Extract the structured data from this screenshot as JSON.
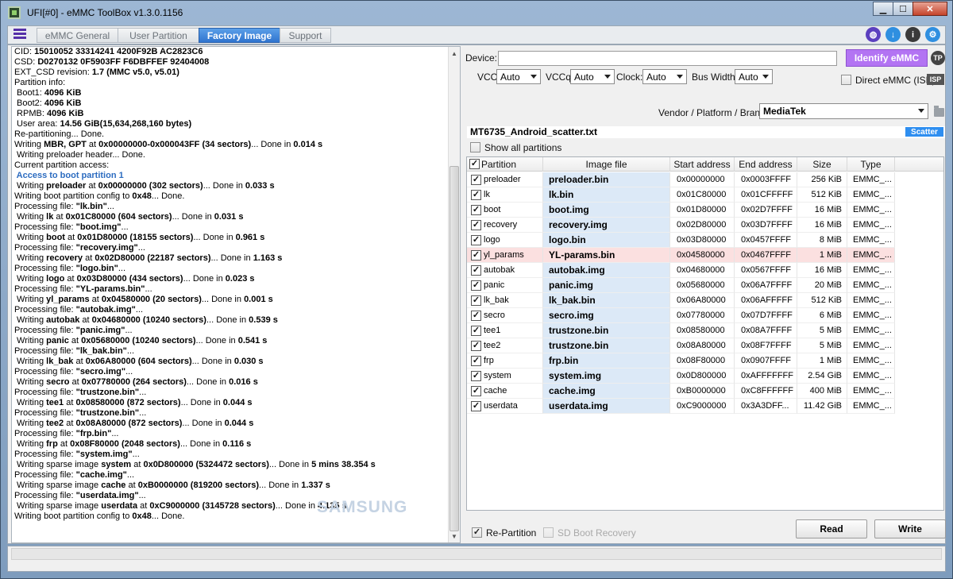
{
  "window": {
    "title": "UFI[#0] - eMMC ToolBox v1.3.0.1156"
  },
  "tabs": [
    {
      "label": "eMMC General",
      "active": false
    },
    {
      "label": "User Partition",
      "active": false
    },
    {
      "label": "Factory Image",
      "active": true
    },
    {
      "label": "Support",
      "active": false
    }
  ],
  "log": {
    "watermark": "SAMSUNG",
    "lines": [
      {
        "t": "CID: ",
        "b": "15010052 33314241 4200F92B AC2823C6"
      },
      {
        "t": "CSD: ",
        "b": "D0270132 0F5903FF F6DBFFEF 92404008"
      },
      {
        "t": "EXT_CSD revision: ",
        "b": "1.7 (MMC v5.0, v5.01)"
      },
      {
        "t": "Partition info:"
      },
      {
        "t": " Boot1: ",
        "b": "4096 KiB"
      },
      {
        "t": " Boot2: ",
        "b": "4096 KiB"
      },
      {
        "t": " RPMB: ",
        "b": "4096 KiB"
      },
      {
        "t": " User area: ",
        "b": "14.56 GiB(15,634,268,160 bytes)"
      },
      {
        "t": ""
      },
      {
        "t": "Re-partitioning... Done."
      },
      {
        "t": "Writing ",
        "b": "MBR, GPT",
        "t2": " at ",
        "b2": "0x00000000-0x000043FF (34 sectors)",
        "t3": "... Done in ",
        "b3": "0.014 s"
      },
      {
        "t": " Writing preloader header... Done."
      },
      {
        "t": "Current partition access:"
      },
      {
        "t": " Access to boot partition 1",
        "blue": true
      },
      {
        "t": " Writing ",
        "b": "preloader",
        "t2": " at ",
        "b2": "0x00000000 (302 sectors)",
        "t3": "... Done in ",
        "b3": "0.033 s"
      },
      {
        "t": "Writing boot partition config to ",
        "b": "0x48",
        "t2": "... Done."
      },
      {
        "t": "Processing file: ",
        "b": "\"lk.bin\"",
        "t2": "..."
      },
      {
        "t": " Writing ",
        "b": "lk",
        "t2": " at ",
        "b2": "0x01C80000 (604 sectors)",
        "t3": "... Done in ",
        "b3": "0.031 s"
      },
      {
        "t": "Processing file: ",
        "b": "\"boot.img\"",
        "t2": "..."
      },
      {
        "t": " Writing ",
        "b": "boot",
        "t2": " at ",
        "b2": "0x01D80000 (18155 sectors)",
        "t3": "... Done in ",
        "b3": "0.961 s"
      },
      {
        "t": "Processing file: ",
        "b": "\"recovery.img\"",
        "t2": "..."
      },
      {
        "t": " Writing ",
        "b": "recovery",
        "t2": " at ",
        "b2": "0x02D80000 (22187 sectors)",
        "t3": "... Done in ",
        "b3": "1.163 s"
      },
      {
        "t": "Processing file: ",
        "b": "\"logo.bin\"",
        "t2": "..."
      },
      {
        "t": " Writing ",
        "b": "logo",
        "t2": " at ",
        "b2": "0x03D80000 (434 sectors)",
        "t3": "... Done in ",
        "b3": "0.023 s"
      },
      {
        "t": "Processing file: ",
        "b": "\"YL-params.bin\"",
        "t2": "..."
      },
      {
        "t": " Writing ",
        "b": "yl_params",
        "t2": " at ",
        "b2": "0x04580000 (20 sectors)",
        "t3": "... Done in ",
        "b3": "0.001 s"
      },
      {
        "t": "Processing file: ",
        "b": "\"autobak.img\"",
        "t2": "..."
      },
      {
        "t": " Writing ",
        "b": "autobak",
        "t2": " at ",
        "b2": "0x04680000 (10240 sectors)",
        "t3": "... Done in ",
        "b3": "0.539 s"
      },
      {
        "t": "Processing file: ",
        "b": "\"panic.img\"",
        "t2": "..."
      },
      {
        "t": " Writing ",
        "b": "panic",
        "t2": " at ",
        "b2": "0x05680000 (10240 sectors)",
        "t3": "... Done in ",
        "b3": "0.541 s"
      },
      {
        "t": "Processing file: ",
        "b": "\"lk_bak.bin\"",
        "t2": "..."
      },
      {
        "t": " Writing ",
        "b": "lk_bak",
        "t2": " at ",
        "b2": "0x06A80000 (604 sectors)",
        "t3": "... Done in ",
        "b3": "0.030 s"
      },
      {
        "t": "Processing file: ",
        "b": "\"secro.img\"",
        "t2": "..."
      },
      {
        "t": " Writing ",
        "b": "secro",
        "t2": " at ",
        "b2": "0x07780000 (264 sectors)",
        "t3": "... Done in ",
        "b3": "0.016 s"
      },
      {
        "t": "Processing file: ",
        "b": "\"trustzone.bin\"",
        "t2": "..."
      },
      {
        "t": " Writing ",
        "b": "tee1",
        "t2": " at ",
        "b2": "0x08580000 (872 sectors)",
        "t3": "... Done in ",
        "b3": "0.044 s"
      },
      {
        "t": "Processing file: ",
        "b": "\"trustzone.bin\"",
        "t2": "..."
      },
      {
        "t": " Writing ",
        "b": "tee2",
        "t2": " at ",
        "b2": "0x08A80000 (872 sectors)",
        "t3": "... Done in ",
        "b3": "0.044 s"
      },
      {
        "t": "Processing file: ",
        "b": "\"frp.bin\"",
        "t2": "..."
      },
      {
        "t": " Writing ",
        "b": "frp",
        "t2": " at ",
        "b2": "0x08F80000 (2048 sectors)",
        "t3": "... Done in ",
        "b3": "0.116 s"
      },
      {
        "t": "Processing file: ",
        "b": "\"system.img\"",
        "t2": "..."
      },
      {
        "t": " Writing sparse image ",
        "b": "system",
        "t2": " at ",
        "b2": "0x0D800000 (5324472 sectors)",
        "t3": "... Done in ",
        "b3": "5 mins 38.354 s"
      },
      {
        "t": "Processing file: ",
        "b": "\"cache.img\"",
        "t2": "..."
      },
      {
        "t": " Writing sparse image ",
        "b": "cache",
        "t2": " at ",
        "b2": "0xB0000000 (819200 sectors)",
        "t3": "... Done in ",
        "b3": "1.337 s"
      },
      {
        "t": "Processing file: ",
        "b": "\"userdata.img\"",
        "t2": "..."
      },
      {
        "t": " Writing sparse image ",
        "b": "userdata",
        "t2": " at ",
        "b2": "0xC9000000 (3145728 sectors)",
        "t3": "... Done in ",
        "b3": "4.135 s"
      },
      {
        "t": "Writing boot partition config to ",
        "b": "0x48",
        "t2": "... Done."
      }
    ]
  },
  "device": {
    "label": "Device:",
    "value": "",
    "identify_label": "Identify eMMC",
    "tp_label": "TP",
    "vcc_label": "VCC:",
    "vcc_value": "Auto",
    "vccq_label": "VCCq:",
    "vccq_value": "Auto",
    "clock_label": "Clock:",
    "clock_value": "Auto",
    "buswidth_label": "Bus Width:",
    "buswidth_value": "Auto",
    "direct_label": "Direct eMMC (ISP)",
    "isp_badge": "ISP",
    "vendor_label": "Vendor / Platform / Brand:",
    "vendor_value": "MediaTek"
  },
  "scatter": {
    "filename": "MT6735_Android_scatter.txt",
    "button": "Scatter"
  },
  "show_all_label": "Show all partitions",
  "table": {
    "headers": [
      "Partition",
      "Image file",
      "Start address",
      "End address",
      "Size",
      "Type"
    ],
    "rows": [
      {
        "partition": "preloader",
        "file": "preloader.bin",
        "start": "0x00000000",
        "end": "0x0003FFFF",
        "size": "256 KiB",
        "type": "EMMC_..."
      },
      {
        "partition": "lk",
        "file": "lk.bin",
        "start": "0x01C80000",
        "end": "0x01CFFFFF",
        "size": "512 KiB",
        "type": "EMMC_..."
      },
      {
        "partition": "boot",
        "file": "boot.img",
        "start": "0x01D80000",
        "end": "0x02D7FFFF",
        "size": "16 MiB",
        "type": "EMMC_..."
      },
      {
        "partition": "recovery",
        "file": "recovery.img",
        "start": "0x02D80000",
        "end": "0x03D7FFFF",
        "size": "16 MiB",
        "type": "EMMC_..."
      },
      {
        "partition": "logo",
        "file": "logo.bin",
        "start": "0x03D80000",
        "end": "0x0457FFFF",
        "size": "8 MiB",
        "type": "EMMC_..."
      },
      {
        "partition": "yl_params",
        "file": "YL-params.bin",
        "start": "0x04580000",
        "end": "0x0467FFFF",
        "size": "1 MiB",
        "type": "EMMC_...",
        "highlight": true
      },
      {
        "partition": "autobak",
        "file": "autobak.img",
        "start": "0x04680000",
        "end": "0x0567FFFF",
        "size": "16 MiB",
        "type": "EMMC_..."
      },
      {
        "partition": "panic",
        "file": "panic.img",
        "start": "0x05680000",
        "end": "0x06A7FFFF",
        "size": "20 MiB",
        "type": "EMMC_..."
      },
      {
        "partition": "lk_bak",
        "file": "lk_bak.bin",
        "start": "0x06A80000",
        "end": "0x06AFFFFF",
        "size": "512 KiB",
        "type": "EMMC_..."
      },
      {
        "partition": "secro",
        "file": "secro.img",
        "start": "0x07780000",
        "end": "0x07D7FFFF",
        "size": "6 MiB",
        "type": "EMMC_..."
      },
      {
        "partition": "tee1",
        "file": "trustzone.bin",
        "start": "0x08580000",
        "end": "0x08A7FFFF",
        "size": "5 MiB",
        "type": "EMMC_..."
      },
      {
        "partition": "tee2",
        "file": "trustzone.bin",
        "start": "0x08A80000",
        "end": "0x08F7FFFF",
        "size": "5 MiB",
        "type": "EMMC_..."
      },
      {
        "partition": "frp",
        "file": "frp.bin",
        "start": "0x08F80000",
        "end": "0x0907FFFF",
        "size": "1 MiB",
        "type": "EMMC_..."
      },
      {
        "partition": "system",
        "file": "system.img",
        "start": "0x0D800000",
        "end": "0xAFFFFFFF",
        "size": "2.54 GiB",
        "type": "EMMC_..."
      },
      {
        "partition": "cache",
        "file": "cache.img",
        "start": "0xB0000000",
        "end": "0xC8FFFFFF",
        "size": "400 MiB",
        "type": "EMMC_..."
      },
      {
        "partition": "userdata",
        "file": "userdata.img",
        "start": "0xC9000000",
        "end": "0x3A3DFF...",
        "size": "11.42 GiB",
        "type": "EMMC_..."
      }
    ]
  },
  "footer": {
    "repartition_label": "Re-Partition",
    "sdboot_label": "SD Boot Recovery",
    "read_label": "Read",
    "write_label": "Write"
  },
  "colors": {
    "accent_tab": "#2f74cf",
    "identify_button": "#b374f3",
    "scatter_button": "#2e8ef0",
    "file_cell": "#dce9f7",
    "highlight_row": "#fbe0e0"
  },
  "icons": [
    "globe-icon",
    "download-icon",
    "info-icon",
    "settings-icon"
  ]
}
